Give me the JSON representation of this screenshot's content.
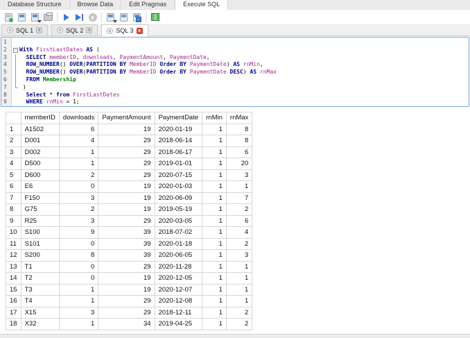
{
  "main_tabs": [
    {
      "label": "Database Structure",
      "active": false
    },
    {
      "label": "Browse Data",
      "active": false
    },
    {
      "label": "Edit Pragmas",
      "active": false
    },
    {
      "label": "Execute SQL",
      "active": true
    }
  ],
  "toolbar": {
    "icons": [
      {
        "name": "new-sql-tab-icon",
        "kind": "doc-green"
      },
      {
        "name": "open-sql-file-icon",
        "kind": "doc"
      },
      {
        "name": "save-sql-file-icon",
        "kind": "doc",
        "caret": true
      },
      {
        "name": "print-icon",
        "kind": "printer"
      },
      {
        "sep": true
      },
      {
        "name": "execute-all-icon",
        "kind": "play"
      },
      {
        "name": "execute-current-line-icon",
        "kind": "play-line"
      },
      {
        "name": "stop-icon",
        "kind": "stop",
        "glyph": "x"
      },
      {
        "sep": true
      },
      {
        "name": "save-results-icon",
        "kind": "doc",
        "caret": true
      },
      {
        "name": "export-results-icon",
        "kind": "doc-band2"
      },
      {
        "name": "open-results-icon",
        "kind": "doc-corner"
      },
      {
        "sep": true
      },
      {
        "name": "table-view-icon",
        "kind": "table-green"
      }
    ]
  },
  "sql_tabs": [
    {
      "label": "SQL 1",
      "active": false,
      "close_glyph": "x"
    },
    {
      "label": "SQL 2",
      "active": false,
      "close_glyph": "x"
    },
    {
      "label": "SQL 3",
      "active": true,
      "close_glyph": "x"
    }
  ],
  "editor": {
    "fold_marker": "-",
    "lines": [
      {
        "num": 1,
        "fold": "",
        "segments": []
      },
      {
        "num": 2,
        "fold": "box",
        "segments": [
          {
            "t": "With",
            "c": "kw"
          },
          {
            "t": " "
          },
          {
            "t": "FirstLastDates",
            "c": "id"
          },
          {
            "t": " "
          },
          {
            "t": "AS",
            "c": "kw"
          },
          {
            "t": " ("
          }
        ]
      },
      {
        "num": 3,
        "fold": "pipe",
        "segments": [
          {
            "t": "  "
          },
          {
            "t": "SELECT",
            "c": "kw"
          },
          {
            "t": " "
          },
          {
            "t": "memberID",
            "c": "id"
          },
          {
            "t": ", "
          },
          {
            "t": "downloads",
            "c": "id"
          },
          {
            "t": ", "
          },
          {
            "t": "PaymentAmount",
            "c": "id"
          },
          {
            "t": ", "
          },
          {
            "t": "PaymentDate",
            "c": "id"
          },
          {
            "t": ","
          }
        ]
      },
      {
        "num": 4,
        "fold": "pipe",
        "segments": [
          {
            "t": "  "
          },
          {
            "t": "ROW_NUMBER",
            "c": "kw"
          },
          {
            "t": "() "
          },
          {
            "t": "OVER",
            "c": "kw"
          },
          {
            "t": "("
          },
          {
            "t": "PARTITION BY",
            "c": "kw"
          },
          {
            "t": " "
          },
          {
            "t": "MemberID",
            "c": "id"
          },
          {
            "t": " "
          },
          {
            "t": "Order BY",
            "c": "kw"
          },
          {
            "t": " "
          },
          {
            "t": "PaymentDate",
            "c": "id"
          },
          {
            "t": ") "
          },
          {
            "t": "AS",
            "c": "kw"
          },
          {
            "t": " "
          },
          {
            "t": "rnMin",
            "c": "id"
          },
          {
            "t": ","
          }
        ]
      },
      {
        "num": 5,
        "fold": "pipe",
        "segments": [
          {
            "t": "  "
          },
          {
            "t": "ROW_NUMBER",
            "c": "kw"
          },
          {
            "t": "() "
          },
          {
            "t": "OVER",
            "c": "kw"
          },
          {
            "t": "("
          },
          {
            "t": "PARTITION BY",
            "c": "kw"
          },
          {
            "t": " "
          },
          {
            "t": "MemberID",
            "c": "id"
          },
          {
            "t": " "
          },
          {
            "t": "Order BY",
            "c": "kw"
          },
          {
            "t": " "
          },
          {
            "t": "PaymentDate",
            "c": "id"
          },
          {
            "t": " "
          },
          {
            "t": "DESC",
            "c": "kw"
          },
          {
            "t": ") "
          },
          {
            "t": "AS",
            "c": "kw"
          },
          {
            "t": " "
          },
          {
            "t": "rnMax",
            "c": "id"
          }
        ]
      },
      {
        "num": 6,
        "fold": "pipe",
        "segments": [
          {
            "t": "  "
          },
          {
            "t": "FROM",
            "c": "kw"
          },
          {
            "t": " "
          },
          {
            "t": "Membership",
            "c": "tbl"
          }
        ]
      },
      {
        "num": 7,
        "fold": "corner",
        "segments": [
          {
            "t": " )"
          }
        ]
      },
      {
        "num": 8,
        "fold": "",
        "segments": [
          {
            "t": "  "
          },
          {
            "t": "Select",
            "c": "kw"
          },
          {
            "t": " * "
          },
          {
            "t": "from",
            "c": "kw"
          },
          {
            "t": " "
          },
          {
            "t": "FirstLastDates",
            "c": "id"
          }
        ]
      },
      {
        "num": 9,
        "fold": "",
        "segments": [
          {
            "t": "  "
          },
          {
            "t": "WHERE",
            "c": "kw"
          },
          {
            "t": " "
          },
          {
            "t": "rnMin",
            "c": "id"
          },
          {
            "t": " = 1;"
          }
        ]
      }
    ]
  },
  "results": {
    "columns": [
      "memberID",
      "downloads",
      "PaymentAmount",
      "PaymentDate",
      "rnMin",
      "rnMax"
    ],
    "col_align": [
      "left",
      "right",
      "right",
      "left",
      "right",
      "right"
    ],
    "rows": [
      [
        "A1502",
        6,
        19,
        "2020-01-19",
        1,
        8
      ],
      [
        "D001",
        4,
        29,
        "2018-06-14",
        1,
        8
      ],
      [
        "D002",
        1,
        29,
        "2018-06-17",
        1,
        6
      ],
      [
        "D500",
        1,
        29,
        "2019-01-01",
        1,
        20
      ],
      [
        "D600",
        2,
        29,
        "2020-07-15",
        1,
        3
      ],
      [
        "E6",
        0,
        19,
        "2020-01-03",
        1,
        1
      ],
      [
        "F150",
        3,
        19,
        "2020-06-09",
        1,
        7
      ],
      [
        "G75",
        2,
        19,
        "2019-05-19",
        1,
        2
      ],
      [
        "R25",
        3,
        29,
        "2020-03-05",
        1,
        6
      ],
      [
        "S100",
        9,
        39,
        "2018-07-02",
        1,
        4
      ],
      [
        "S101",
        0,
        39,
        "2020-01-18",
        1,
        2
      ],
      [
        "S200",
        8,
        39,
        "2020-06-05",
        1,
        3
      ],
      [
        "T1",
        0,
        29,
        "2020-11-28",
        1,
        1
      ],
      [
        "T2",
        0,
        19,
        "2020-12-05",
        1,
        1
      ],
      [
        "T3",
        1,
        19,
        "2020-12-07",
        1,
        1
      ],
      [
        "T4",
        1,
        29,
        "2020-12-08",
        1,
        1
      ],
      [
        "X15",
        3,
        29,
        "2018-12-11",
        1,
        2
      ],
      [
        "X32",
        1,
        34,
        "2019-04-25",
        1,
        2
      ]
    ]
  },
  "colors": {
    "keyword": "#00008b",
    "identifier": "#a02890",
    "table_name": "#008000",
    "editor_border": "#78a2d4",
    "active_close": "#e04a33"
  }
}
